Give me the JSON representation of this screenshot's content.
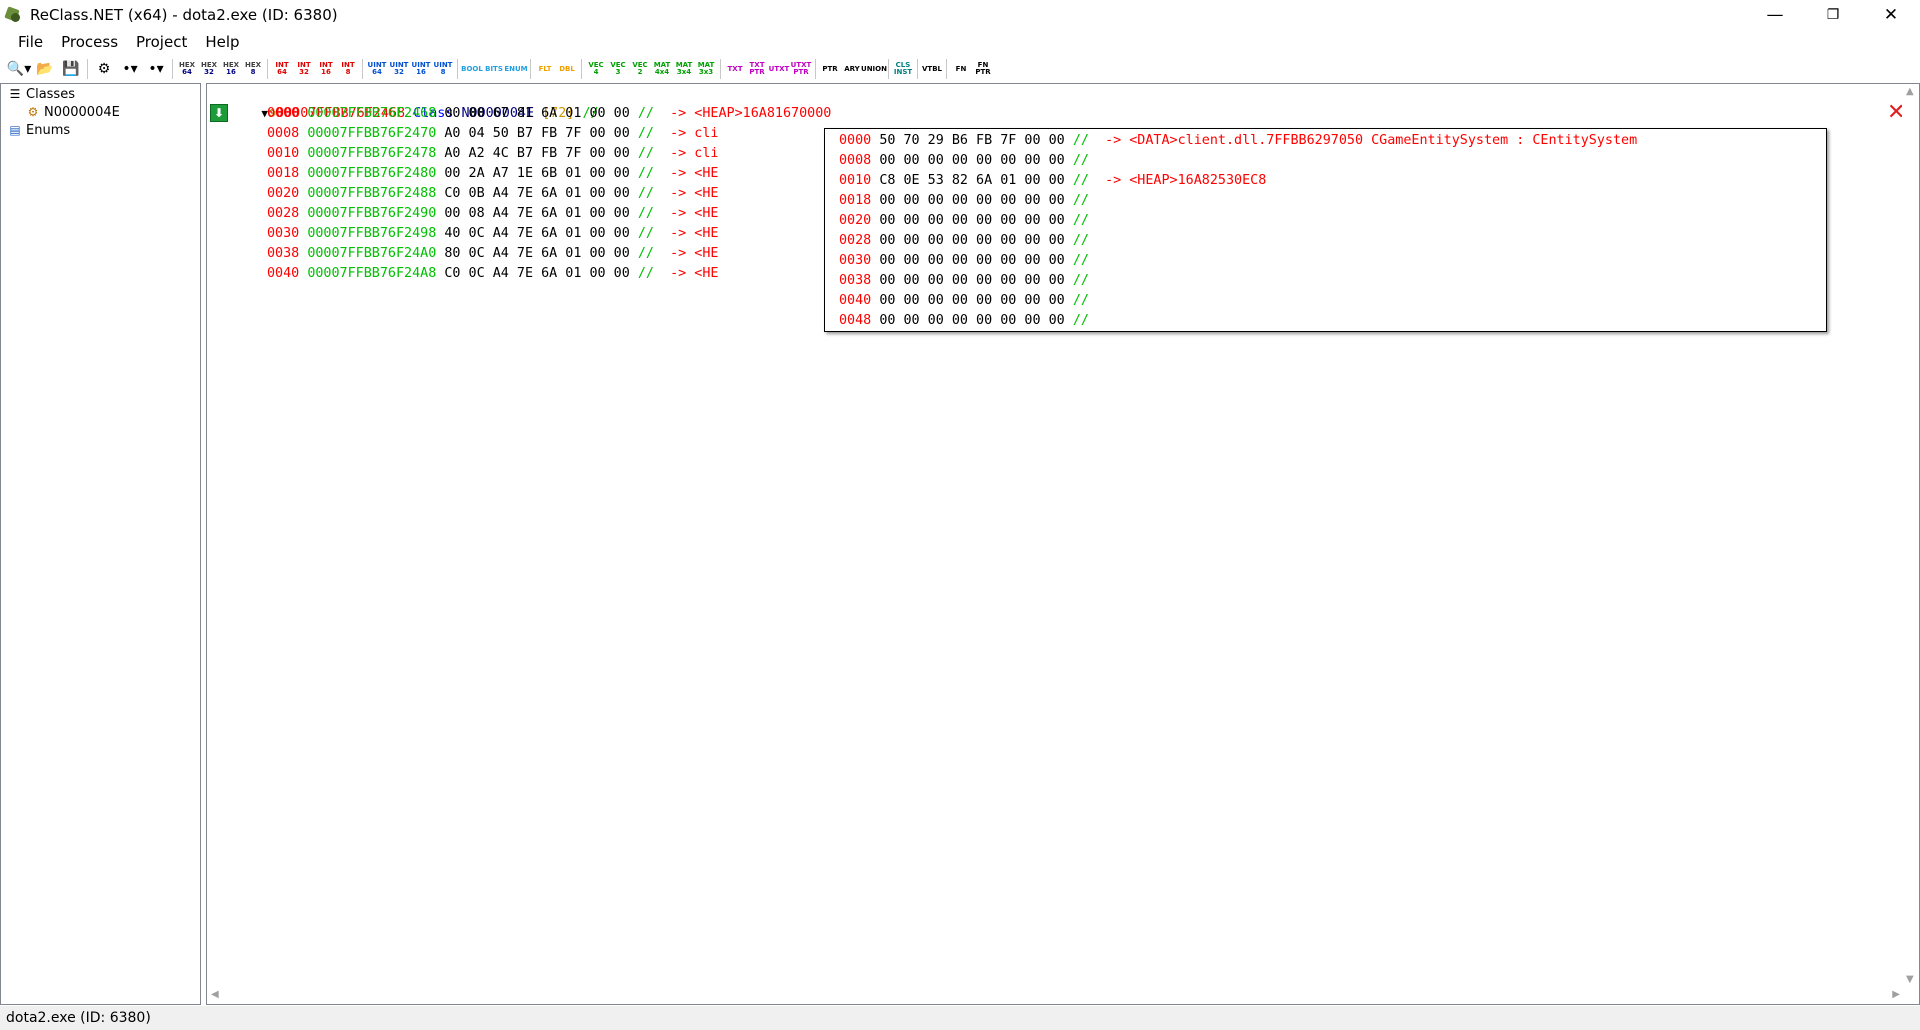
{
  "window": {
    "title": "ReClass.NET (x64) - dota2.exe (ID: 6380)",
    "minimize": "—",
    "maximize": "❐",
    "close": "✕"
  },
  "menu": [
    "File",
    "Process",
    "Project",
    "Help"
  ],
  "toolbar": {
    "groups": [
      [
        {
          "t1": "🔍▾",
          "big": true,
          "name": "attach-process-icon"
        },
        {
          "t1": "📂",
          "big": true,
          "name": "open-project-icon"
        },
        {
          "t1": "💾",
          "big": true,
          "name": "save-project-icon"
        }
      ],
      [
        {
          "t1": "⚙",
          "big": true,
          "name": "add-class-icon"
        },
        {
          "t1": "•▾",
          "big": true,
          "name": "add-bytes-icon"
        },
        {
          "t1": "•▾",
          "big": true,
          "name": "insert-bytes-icon"
        }
      ],
      [
        {
          "t1": "HEX",
          "t2": "64",
          "c": "#000080"
        },
        {
          "t1": "HEX",
          "t2": "32",
          "c": "#000080"
        },
        {
          "t1": "HEX",
          "t2": "16",
          "c": "#000080"
        },
        {
          "t1": "HEX",
          "t2": "8",
          "c": "#000080"
        }
      ],
      [
        {
          "t1": "INT",
          "t2": "64",
          "c": "#e00000"
        },
        {
          "t1": "INT",
          "t2": "32",
          "c": "#e00000"
        },
        {
          "t1": "INT",
          "t2": "16",
          "c": "#e00000"
        },
        {
          "t1": "INT",
          "t2": "8",
          "c": "#e00000"
        }
      ],
      [
        {
          "t1": "UINT",
          "t2": "64",
          "c": "#0050d0"
        },
        {
          "t1": "UINT",
          "t2": "32",
          "c": "#0050d0"
        },
        {
          "t1": "UINT",
          "t2": "16",
          "c": "#0050d0"
        },
        {
          "t1": "UINT",
          "t2": "8",
          "c": "#0050d0"
        }
      ],
      [
        {
          "t1": "BOOL",
          "t2": "",
          "c": "#20a0e0"
        },
        {
          "t1": "BITS",
          "t2": "",
          "c": "#20a0e0"
        },
        {
          "t1": "ENUM",
          "t2": "",
          "c": "#20a0e0"
        }
      ],
      [
        {
          "t1": "FLT",
          "t2": "",
          "c": "#f0a000"
        },
        {
          "t1": "DBL",
          "t2": "",
          "c": "#f0a000"
        }
      ],
      [
        {
          "t1": "VEC",
          "t2": "4",
          "c": "#00a000"
        },
        {
          "t1": "VEC",
          "t2": "3",
          "c": "#00a000"
        },
        {
          "t1": "VEC",
          "t2": "2",
          "c": "#00a000"
        },
        {
          "t1": "MAT",
          "t2": "4x4",
          "c": "#00a000"
        },
        {
          "t1": "MAT",
          "t2": "3x4",
          "c": "#00a000"
        },
        {
          "t1": "MAT",
          "t2": "3x3",
          "c": "#00a000"
        }
      ],
      [
        {
          "t1": "TXT",
          "t2": "",
          "c": "#c000c0"
        },
        {
          "t1": "TXT",
          "t2": "PTR",
          "c": "#c000c0"
        },
        {
          "t1": "UTXT",
          "t2": "",
          "c": "#c000c0"
        },
        {
          "t1": "UTXT",
          "t2": "PTR",
          "c": "#c000c0"
        }
      ],
      [
        {
          "t1": "PTR",
          "t2": "",
          "c": "#000000"
        },
        {
          "t1": "ARY",
          "t2": "",
          "c": "#000000"
        },
        {
          "t1": "UNION",
          "t2": "",
          "c": "#000000"
        }
      ],
      [
        {
          "t1": "CLS",
          "t2": "INST",
          "c": "#008080"
        }
      ],
      [
        {
          "t1": "VTBL",
          "t2": "",
          "c": "#000000"
        }
      ],
      [
        {
          "t1": "FN",
          "t2": "",
          "c": "#000000"
        },
        {
          "t1": "FN",
          "t2": "PTR",
          "c": "#000000"
        }
      ]
    ]
  },
  "sidebar": {
    "classes_label": "Classes",
    "class_item": "N0000004E",
    "enums_label": "Enums"
  },
  "class_header": {
    "address": "00007FFBB76F2468",
    "keyword": "Class",
    "name": "N0000004E",
    "size": "[72]",
    "comment": "//"
  },
  "rows": [
    {
      "offset": "0000",
      "address": "00007FFBB76F2468",
      "bytes": "00 00 67 81 6A 01 00 00",
      "comment": "//",
      "pointer": "-> <HEAP>16A81670000"
    },
    {
      "offset": "0008",
      "address": "00007FFBB76F2470",
      "bytes": "A0 04 50 B7 FB 7F 00 00",
      "comment": "//",
      "pointer": "-> cli"
    },
    {
      "offset": "0010",
      "address": "00007FFBB76F2478",
      "bytes": "A0 A2 4C B7 FB 7F 00 00",
      "comment": "//",
      "pointer": "-> cli"
    },
    {
      "offset": "0018",
      "address": "00007FFBB76F2480",
      "bytes": "00 2A A7 1E 6B 01 00 00",
      "comment": "//",
      "pointer": "-> <HE"
    },
    {
      "offset": "0020",
      "address": "00007FFBB76F2488",
      "bytes": "C0 0B A4 7E 6A 01 00 00",
      "comment": "//",
      "pointer": "-> <HE"
    },
    {
      "offset": "0028",
      "address": "00007FFBB76F2490",
      "bytes": "00 08 A4 7E 6A 01 00 00",
      "comment": "//",
      "pointer": "-> <HE"
    },
    {
      "offset": "0030",
      "address": "00007FFBB76F2498",
      "bytes": "40 0C A4 7E 6A 01 00 00",
      "comment": "//",
      "pointer": "-> <HE"
    },
    {
      "offset": "0038",
      "address": "00007FFBB76F24A0",
      "bytes": "80 0C A4 7E 6A 01 00 00",
      "comment": "//",
      "pointer": "-> <HE"
    },
    {
      "offset": "0040",
      "address": "00007FFBB76F24A8",
      "bytes": "C0 0C A4 7E 6A 01 00 00",
      "comment": "//",
      "pointer": "-> <HE"
    }
  ],
  "popup_rows": [
    {
      "offset": "0000",
      "bytes": "50 70 29 B6 FB 7F 00 00",
      "comment": "//",
      "pointer": "-> <DATA>client.dll.7FFBB6297050 CGameEntitySystem : CEntitySystem"
    },
    {
      "offset": "0008",
      "bytes": "00 00 00 00 00 00 00 00",
      "comment": "//",
      "pointer": ""
    },
    {
      "offset": "0010",
      "bytes": "C8 0E 53 82 6A 01 00 00",
      "comment": "//",
      "pointer": "-> <HEAP>16A82530EC8"
    },
    {
      "offset": "0018",
      "bytes": "00 00 00 00 00 00 00 00",
      "comment": "//",
      "pointer": ""
    },
    {
      "offset": "0020",
      "bytes": "00 00 00 00 00 00 00 00",
      "comment": "//",
      "pointer": ""
    },
    {
      "offset": "0028",
      "bytes": "00 00 00 00 00 00 00 00",
      "comment": "//",
      "pointer": ""
    },
    {
      "offset": "0030",
      "bytes": "00 00 00 00 00 00 00 00",
      "comment": "//",
      "pointer": ""
    },
    {
      "offset": "0038",
      "bytes": "00 00 00 00 00 00 00 00",
      "comment": "//",
      "pointer": ""
    },
    {
      "offset": "0040",
      "bytes": "00 00 00 00 00 00 00 00",
      "comment": "//",
      "pointer": ""
    },
    {
      "offset": "0048",
      "bytes": "00 00 00 00 00 00 00 00",
      "comment": "//",
      "pointer": ""
    }
  ],
  "statusbar": {
    "text": "dota2.exe (ID: 6380)"
  },
  "colors": {
    "offset": "#ff0000",
    "address": "#00c000",
    "bytes": "#000000",
    "comment": "#00c000",
    "pointer": "#ff0000",
    "class_keyword": "#0000ff",
    "class_name": "#000080",
    "class_size": "#cc9900"
  }
}
